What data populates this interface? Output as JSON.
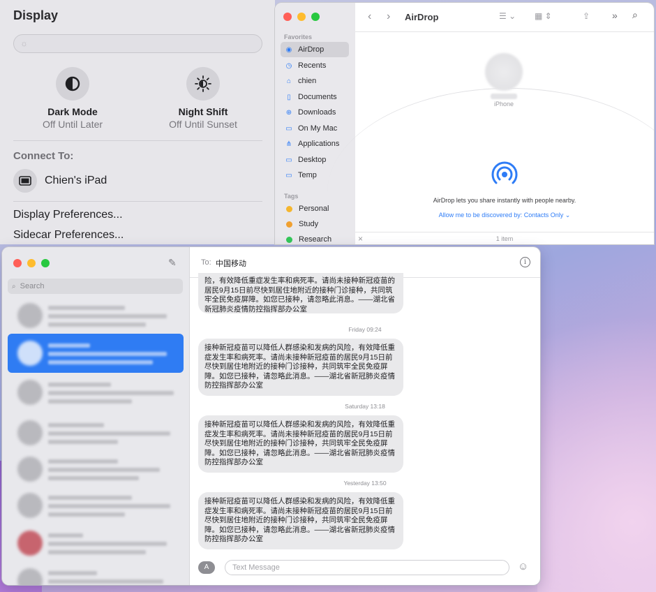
{
  "display": {
    "title": "Display",
    "dark_mode": {
      "name": "Dark Mode",
      "status": "Off Until Later"
    },
    "night_shift": {
      "name": "Night Shift",
      "status": "Off Until Sunset"
    },
    "connect_to": "Connect To:",
    "device": "Chien's iPad",
    "display_prefs": "Display Preferences...",
    "sidecar_prefs": "Sidecar Preferences..."
  },
  "finder": {
    "title": "AirDrop",
    "favorites_label": "Favorites",
    "favorites": [
      {
        "label": "AirDrop",
        "icon": "airdrop-icon"
      },
      {
        "label": "Recents",
        "icon": "clock-icon"
      },
      {
        "label": "chien",
        "icon": "home-icon"
      },
      {
        "label": "Documents",
        "icon": "document-icon"
      },
      {
        "label": "Downloads",
        "icon": "download-icon"
      },
      {
        "label": "On My Mac",
        "icon": "folder-icon"
      },
      {
        "label": "Applications",
        "icon": "applications-icon"
      },
      {
        "label": "Desktop",
        "icon": "desktop-icon"
      },
      {
        "label": "Temp",
        "icon": "folder-icon"
      }
    ],
    "tags_label": "Tags",
    "tags": [
      {
        "label": "Personal",
        "color": "#f5b62e"
      },
      {
        "label": "Study",
        "color": "#f0a030"
      },
      {
        "label": "Research",
        "color": "#34c759"
      }
    ],
    "device_label": "iPhone",
    "description": "AirDrop lets you share instantly with people nearby.",
    "discover_link": "Allow me to be discovered by: Contacts Only",
    "item_count": "1 item",
    "accent_color": "#2e7cf6"
  },
  "messages": {
    "search_placeholder": "Search",
    "to_label": "To:",
    "recipient": "中国移动",
    "input_placeholder": "Text Message",
    "partial_message": "险，有效降低重症发生率和病死率。请尚未接种新冠疫苗的居民9月15日前尽快到居住地附近的接种门诊接种，共同筑牢全民免疫屏障。如您已接种，请忽略此消息。——湖北省新冠肺炎疫情防控指挥部办公室",
    "thread": [
      {
        "timestamp": "Friday 09:24",
        "text": "接种新冠疫苗可以降低人群感染和发病的风险，有效降低重症发生率和病死率。请尚未接种新冠疫苗的居民9月15日前尽快到居住地附近的接种门诊接种，共同筑牢全民免疫屏障。如您已接种，请忽略此消息。——湖北省新冠肺炎疫情防控指挥部办公室"
      },
      {
        "timestamp": "Saturday 13:18",
        "text": "接种新冠疫苗可以降低人群感染和发病的风险，有效降低重症发生率和病死率。请尚未接种新冠疫苗的居民9月15日前尽快到居住地附近的接种门诊接种，共同筑牢全民免疫屏障。如您已接种，请忽略此消息。——湖北省新冠肺炎疫情防控指挥部办公室"
      },
      {
        "timestamp": "Yesterday 13:50",
        "text": "接种新冠疫苗可以降低人群感染和发病的风险，有效降低重症发生率和病死率。请尚未接种新冠疫苗的居民9月15日前尽快到居住地附近的接种门诊接种，共同筑牢全民免疫屏障。如您已接种，请忽略此消息。——湖北省新冠肺炎疫情防控指挥部办公室"
      }
    ]
  }
}
